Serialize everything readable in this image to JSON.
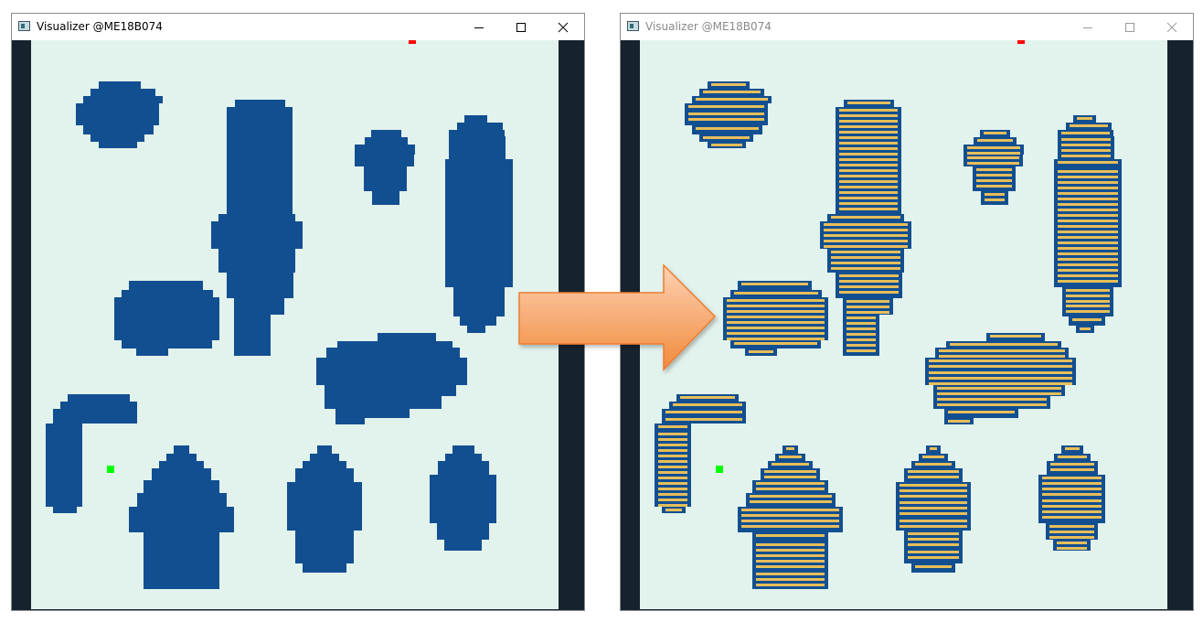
{
  "colors": {
    "canvas": "#e2f2ec",
    "frame": "#16222d",
    "obstacle": "#124f91",
    "stripe": "#e6be5a",
    "start": "#00ff00",
    "goal": "#ff0000",
    "arrow_top": "#fcd1b3",
    "arrow_bottom": "#f28a3b",
    "arrow_border": "#ed7d31"
  },
  "windows": [
    {
      "title": "Visualizer @ME18B074",
      "controls": [
        "minimize-icon",
        "maximize-icon",
        "close-icon"
      ],
      "mode": "solid"
    },
    {
      "title": "Visualizer @ME18B074",
      "controls": [
        "minimize-icon",
        "maximize-icon",
        "close-icon"
      ],
      "mode": "striped"
    }
  ],
  "arrow": {
    "icon": "right-arrow-icon"
  }
}
